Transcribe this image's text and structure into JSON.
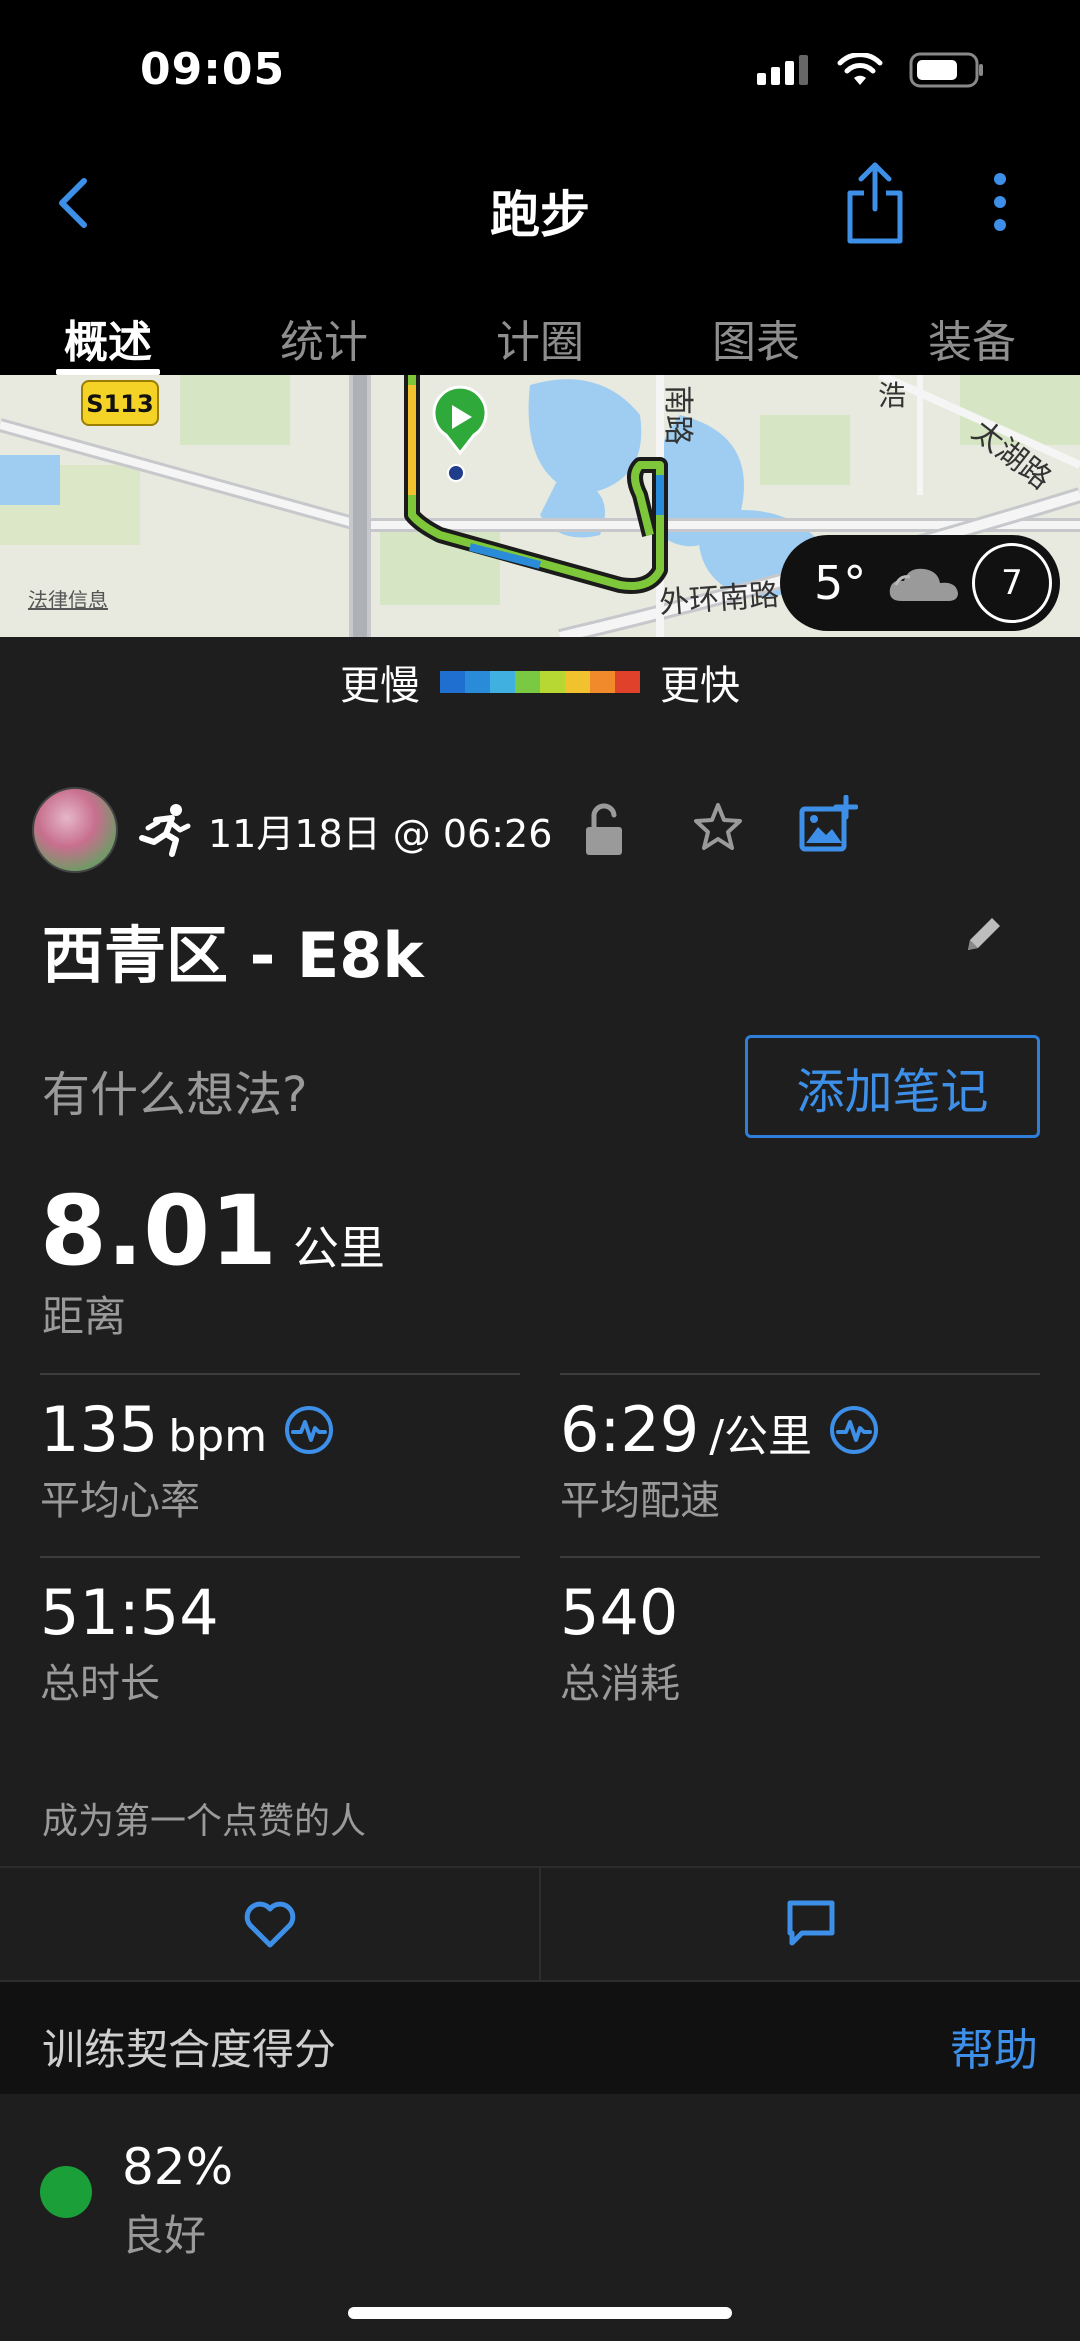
{
  "status_bar": {
    "time": "09:05"
  },
  "nav": {
    "title": "跑步",
    "tabs": [
      {
        "label": "概述",
        "active": true
      },
      {
        "label": "统计",
        "active": false
      },
      {
        "label": "计圈",
        "active": false
      },
      {
        "label": "图表",
        "active": false
      },
      {
        "label": "装备",
        "active": false
      }
    ]
  },
  "map": {
    "road_badge": "S113",
    "legal_link": "法律信息",
    "road_labels": [
      "外环南路",
      "太湖路",
      "南路",
      "浩"
    ],
    "weather": {
      "temperature": "5°",
      "icon": "cloud-icon",
      "wind": "7"
    }
  },
  "speed_legend": {
    "slow_label": "更慢",
    "fast_label": "更快",
    "colors": [
      "#1f6fd1",
      "#2a8bd8",
      "#3fb0e0",
      "#79c942",
      "#b7d832",
      "#f2c12e",
      "#f08a2a",
      "#e0412a"
    ]
  },
  "activity": {
    "date": "11月18日 @ 06:26",
    "title": "西青区 - E8k",
    "notes_prompt": "有什么想法?",
    "add_note_label": "添加笔记"
  },
  "stats": {
    "distance": {
      "value": "8.01",
      "unit": "公里",
      "label": "距离"
    },
    "avg_hr": {
      "value": "135",
      "unit": "bpm",
      "label": "平均心率"
    },
    "avg_pace": {
      "value": "6:29",
      "unit": "/公里",
      "label": "平均配速"
    },
    "duration": {
      "value": "51:54",
      "label": "总时长"
    },
    "calories": {
      "value": "540",
      "label": "总消耗"
    }
  },
  "social": {
    "kudos_text": "成为第一个点赞的人"
  },
  "training_fit": {
    "title": "训练契合度得分",
    "help_label": "帮助",
    "score": "82%",
    "rating": "良好",
    "rating_color": "#1a9f39"
  },
  "colors": {
    "accent": "#3d8fe8",
    "background": "#1e1e1e"
  }
}
